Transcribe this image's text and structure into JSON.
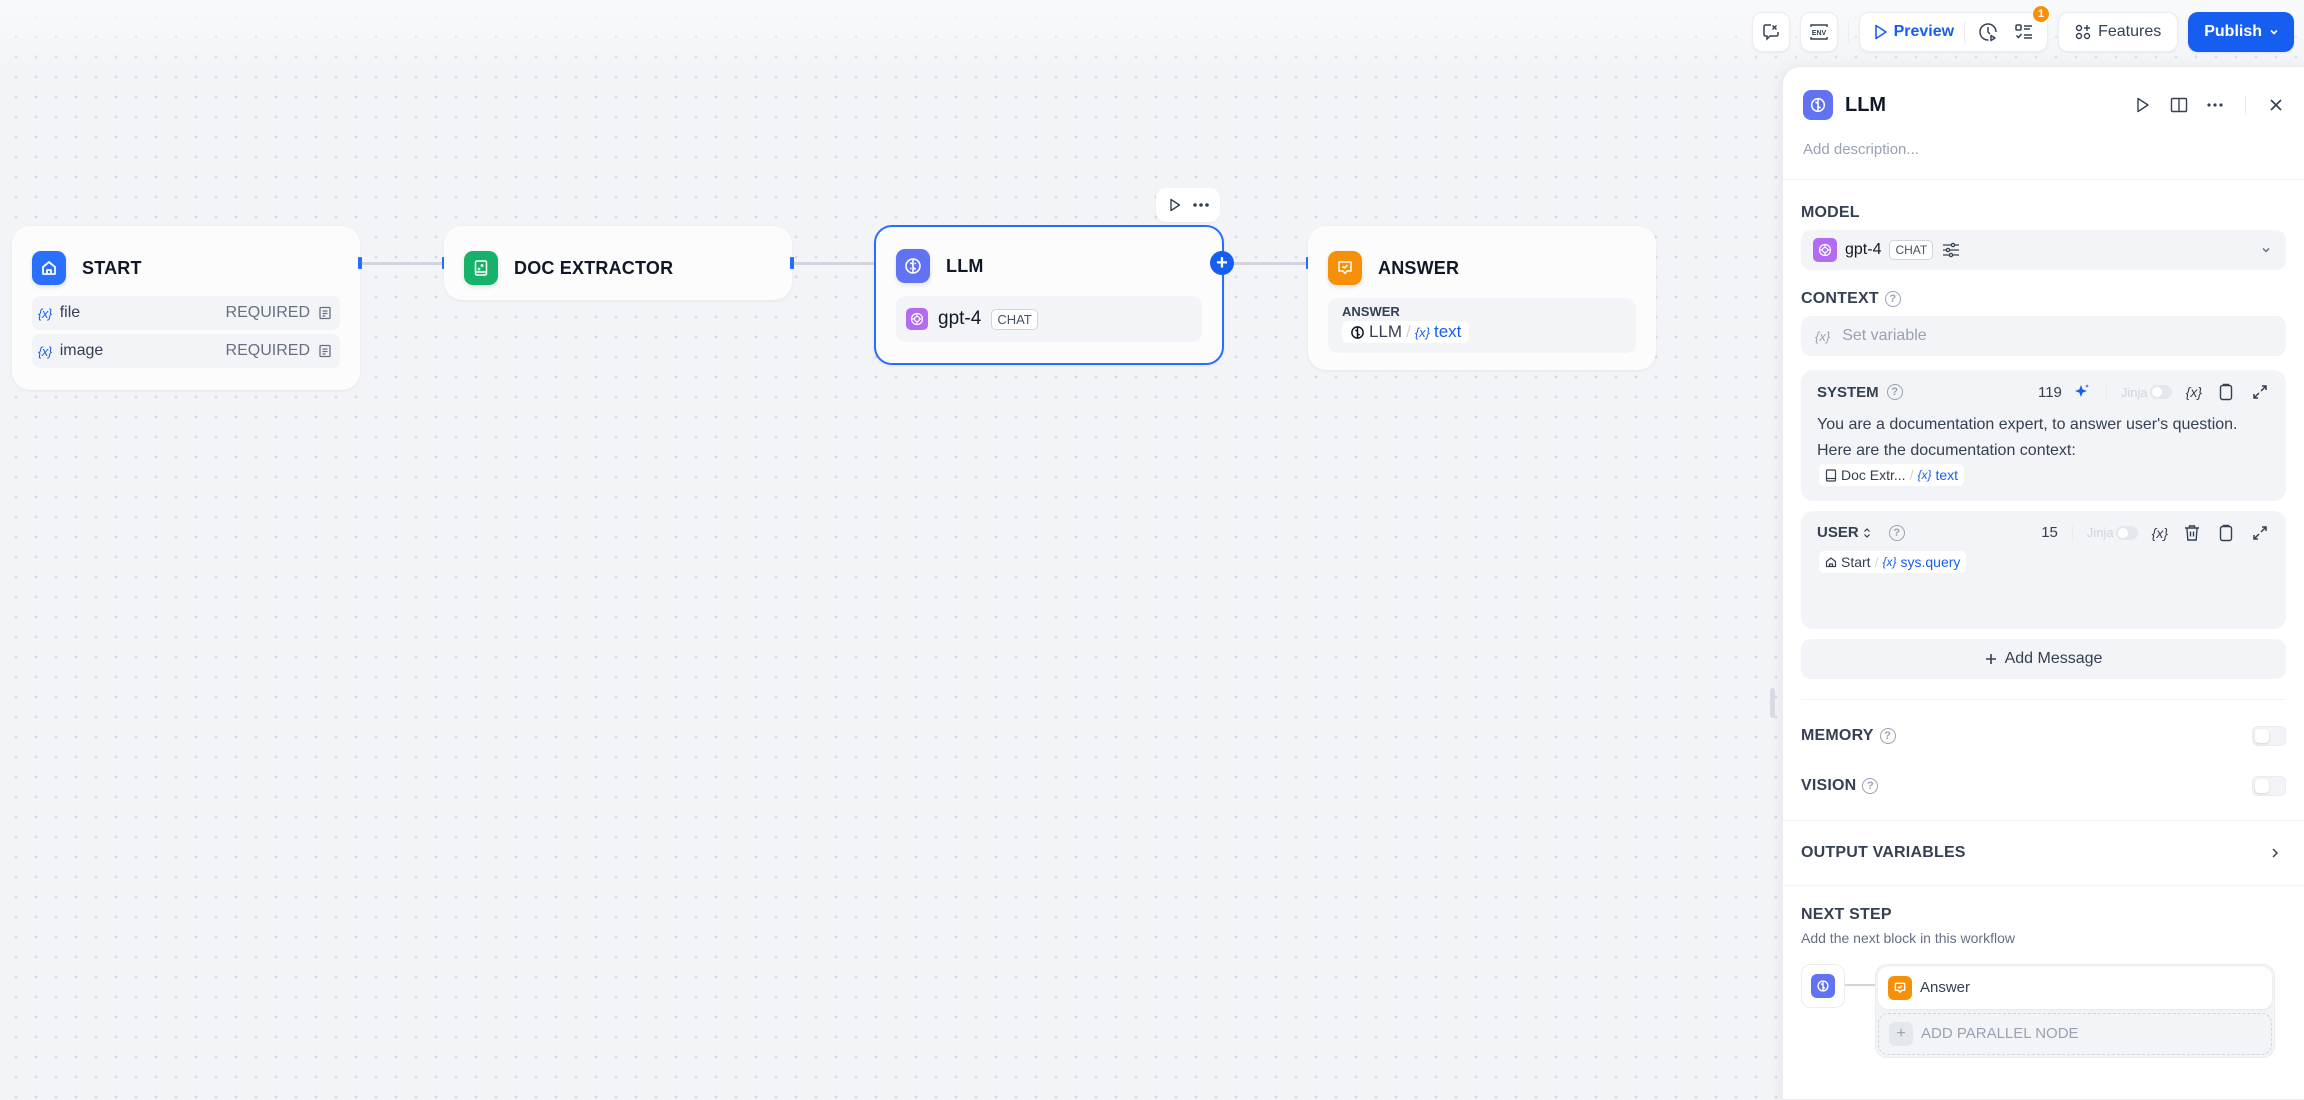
{
  "toolbar": {
    "variable_inspect_icon": "chat-variable-icon",
    "env_icon": "env-icon",
    "env_label": "ENV",
    "preview_label": "Preview",
    "history_icon": "history-icon",
    "checklist_icon": "checklist-icon",
    "checklist_badge": "1",
    "features_label": "Features",
    "publish_label": "Publish"
  },
  "canvas": {
    "nodes": {
      "start": {
        "title": "START",
        "icon": "home-icon",
        "color": "#2970ff",
        "variables": [
          {
            "glyph": "{x}",
            "name": "file",
            "required": "REQUIRED"
          },
          {
            "glyph": "{x}",
            "name": "image",
            "required": "REQUIRED"
          }
        ]
      },
      "doc_extractor": {
        "title": "DOC EXTRACTOR",
        "icon": "doc-extractor-icon",
        "color": "#17b26a"
      },
      "llm": {
        "title": "LLM",
        "icon": "llm-brain-icon",
        "color": "#6172f3",
        "model": "gpt-4",
        "mode": "CHAT",
        "selected": true
      },
      "answer": {
        "title": "ANSWER",
        "icon": "answer-icon",
        "color": "#f79009",
        "field_label": "ANSWER",
        "ref_node": "LLM",
        "ref_sep": "/",
        "ref_glyph": "{x}",
        "ref_var": "text"
      }
    }
  },
  "panel": {
    "title": "LLM",
    "description_placeholder": "Add description...",
    "model": {
      "label": "MODEL",
      "name": "gpt-4",
      "mode": "CHAT"
    },
    "context": {
      "label": "CONTEXT",
      "glyph": "{x}",
      "placeholder": "Set variable"
    },
    "system": {
      "role": "SYSTEM",
      "count": "119",
      "jinja_label": "Jinja",
      "var_glyph": "{x}",
      "text": "You are a documentation expert, to answer user's question. Here are the documentation context:",
      "ref_node": "Doc Extr...",
      "ref_sep": "/",
      "ref_glyph": "{x}",
      "ref_var": "text"
    },
    "user": {
      "role": "USER",
      "count": "15",
      "jinja_label": "Jinja",
      "var_glyph": "{x}",
      "ref_node": "Start",
      "ref_sep": "/",
      "ref_glyph": "{x}",
      "ref_var": "sys.query"
    },
    "add_message_label": "Add Message",
    "memory": {
      "label": "MEMORY",
      "enabled": false
    },
    "vision": {
      "label": "VISION",
      "enabled": false
    },
    "output_variables_label": "OUTPUT VARIABLES",
    "next_step": {
      "label": "NEXT STEP",
      "subtitle": "Add the next block in this workflow",
      "target": "Answer",
      "add_parallel_label": "ADD PARALLEL NODE"
    }
  },
  "colors": {
    "accent": "#155eef",
    "selected_border": "#296dff",
    "badge": "#f79009"
  }
}
